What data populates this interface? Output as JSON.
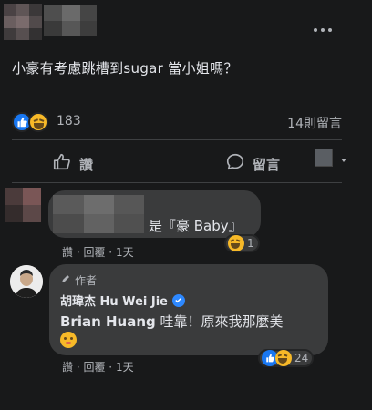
{
  "post": {
    "text": "小豪有考慮跳槽到sugar 當小姐嗎？",
    "reaction_count": "183",
    "comment_count": "14則留言"
  },
  "actions": {
    "like_label": "讚",
    "comment_label": "留言"
  },
  "comments": [
    {
      "text": "是『豪 Baby』",
      "reaction_count": "1",
      "like_label": "讚",
      "reply_label": "回覆",
      "time": "1天"
    },
    {
      "author_tag": "作者",
      "author_name": "胡瑋杰 Hu Wei Jie",
      "mention": "Brian Huang",
      "text": " 哇靠！原來我那麼美",
      "reaction_count": "24",
      "like_label": "讚",
      "reply_label": "回覆",
      "time": "1天"
    }
  ],
  "colors": {
    "background": "#18191a",
    "bubble": "#3a3b3c",
    "primary_text": "#e4e6eb",
    "secondary_text": "#b0b3b8",
    "like_blue": "#1877f2",
    "haha_yellow": "#f7b928",
    "verified_blue": "#2d88ff"
  },
  "icons": {
    "more": "more-icon",
    "like": "thumbs-up-icon",
    "comment": "comment-icon",
    "haha": "haha-emoji-icon",
    "pen": "pen-icon",
    "verified": "verified-badge-icon"
  }
}
